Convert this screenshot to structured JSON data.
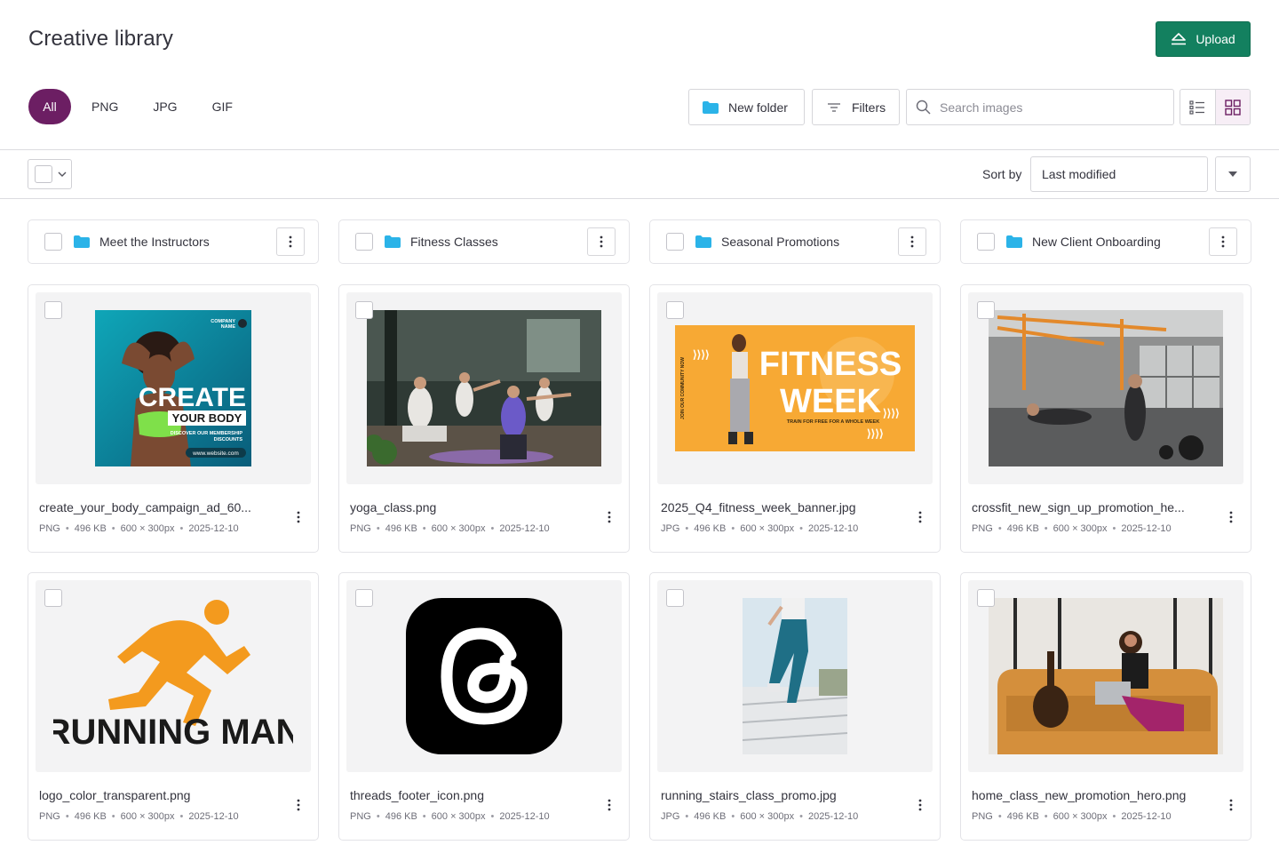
{
  "header": {
    "title": "Creative library",
    "upload_label": "Upload"
  },
  "type_tabs": [
    {
      "label": "All",
      "active": true
    },
    {
      "label": "PNG",
      "active": false
    },
    {
      "label": "JPG",
      "active": false
    },
    {
      "label": "GIF",
      "active": false
    }
  ],
  "toolbar": {
    "new_folder_label": "New folder",
    "filters_label": "Filters",
    "search_placeholder": "Search images",
    "view_mode": "grid"
  },
  "sort": {
    "label": "Sort by",
    "value": "Last modified"
  },
  "folders": [
    {
      "name": "Meet the Instructors"
    },
    {
      "name": "Fitness Classes"
    },
    {
      "name": "Seasonal Promotions"
    },
    {
      "name": "New Client Onboarding"
    }
  ],
  "files": [
    {
      "name": "create_your_body_campaign_ad_60...",
      "type": "PNG",
      "size": "496 KB",
      "dimensions": "600 × 300px",
      "date": "2025-12-10",
      "art_text": {
        "company": "COMPANY",
        "company2": "NAME",
        "line1": "CREATE",
        "line2": "YOUR BODY",
        "line3": "DISCOVER OUR MEMBERSHIP",
        "line4": "DISCOUNTS",
        "url": "www.website.com"
      }
    },
    {
      "name": "yoga_class.png",
      "type": "PNG",
      "size": "496 KB",
      "dimensions": "600 × 300px",
      "date": "2025-12-10"
    },
    {
      "name": "2025_Q4_fitness_week_banner.jpg",
      "type": "JPG",
      "size": "496 KB",
      "dimensions": "600 × 300px",
      "date": "2025-12-10",
      "art_text": {
        "line1": "FITNESS",
        "line2": "WEEK",
        "line3": "TRAIN FOR FREE FOR A WHOLE WEEK",
        "side": "JOIN OUR COMMUNITY NOW"
      }
    },
    {
      "name": "crossfit_new_sign_up_promotion_he...",
      "type": "PNG",
      "size": "496 KB",
      "dimensions": "600 × 300px",
      "date": "2025-12-10"
    },
    {
      "name": "logo_color_transparent.png",
      "type": "PNG",
      "size": "496 KB",
      "dimensions": "600 × 300px",
      "date": "2025-12-10",
      "art_text": {
        "line1": "RUNNING MAN"
      }
    },
    {
      "name": "threads_footer_icon.png",
      "type": "PNG",
      "size": "496 KB",
      "dimensions": "600 × 300px",
      "date": "2025-12-10"
    },
    {
      "name": "running_stairs_class_promo.jpg",
      "type": "JPG",
      "size": "496 KB",
      "dimensions": "600 × 300px",
      "date": "2025-12-10"
    },
    {
      "name": "home_class_new_promotion_hero.png",
      "type": "PNG",
      "size": "496 KB",
      "dimensions": "600 × 300px",
      "date": "2025-12-10"
    }
  ],
  "colors": {
    "accent": "#6c1e63",
    "primary_button": "#13805f",
    "folder_icon": "#2bb3e8"
  }
}
